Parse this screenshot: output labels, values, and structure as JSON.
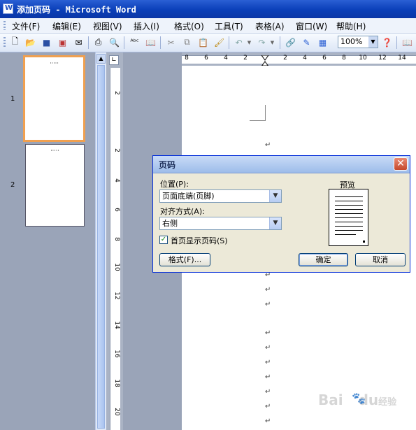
{
  "window": {
    "title": "添加页码 - Microsoft Word",
    "app_icon": "word-app-icon"
  },
  "menu": [
    "文件(F)",
    "编辑(E)",
    "视图(V)",
    "插入(I)",
    "格式(O)",
    "工具(T)",
    "表格(A)",
    "窗口(W)",
    "帮助(H)"
  ],
  "toolbar": {
    "zoom": "100%"
  },
  "thumbnails": {
    "page1": "1",
    "page2": "2"
  },
  "ruler_h": [
    "8",
    "6",
    "4",
    "2",
    "2",
    "4",
    "6",
    "8",
    "10",
    "12",
    "14"
  ],
  "ruler_v": [
    "2",
    "2",
    "4",
    "6",
    "8",
    "10",
    "12",
    "14",
    "16",
    "18",
    "20"
  ],
  "paragraph_mark": "↵",
  "dialog": {
    "title": "页码",
    "position_label": "位置(P):",
    "position_value": "页面底端(页脚)",
    "alignment_label": "对齐方式(A):",
    "alignment_value": "右侧",
    "first_page_label": "首页显示页码(S)",
    "first_page_checked": true,
    "preview_label": "预览",
    "format_button": "格式(F)...",
    "ok_button": "确定",
    "cancel_button": "取消"
  },
  "watermark": {
    "text": "Bai",
    "text2": "du",
    "text3": "经验"
  }
}
